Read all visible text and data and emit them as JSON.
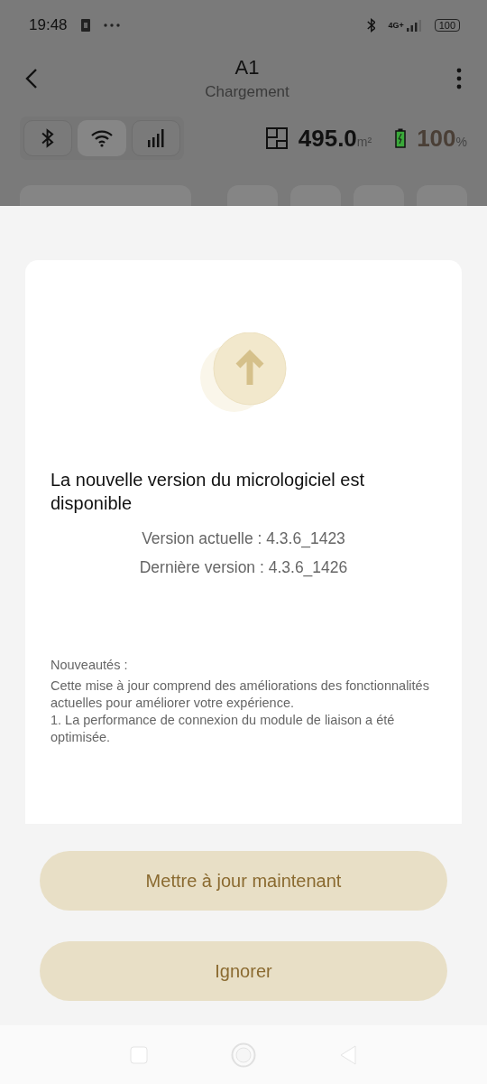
{
  "status_bar": {
    "time": "19:48",
    "network": "4G+",
    "battery": "100"
  },
  "header": {
    "title": "A1",
    "subtitle": "Chargement"
  },
  "connection_tabs": [
    {
      "kind": "bluetooth",
      "selected": false
    },
    {
      "kind": "wifi",
      "selected": true
    },
    {
      "kind": "cellular",
      "selected": false
    }
  ],
  "area": {
    "value": "495.0",
    "unit": "m²"
  },
  "battery": {
    "value": "100",
    "unit": "%"
  },
  "dialog": {
    "title": "La nouvelle version du micrologiciel est disponible",
    "current_version": "Version actuelle : 4.3.6_1423",
    "latest_version": "Dernière version : 4.3.6_1426",
    "notes_heading": "Nouveautés :",
    "notes": [
      "Cette mise à jour comprend des améliorations des fonctionnalités actuelles pour améliorer votre expérience.",
      "1. La performance de connexion du module de liaison a été optimisée."
    ]
  },
  "buttons": [
    "Mettre à jour maintenant",
    "Ignorer"
  ]
}
